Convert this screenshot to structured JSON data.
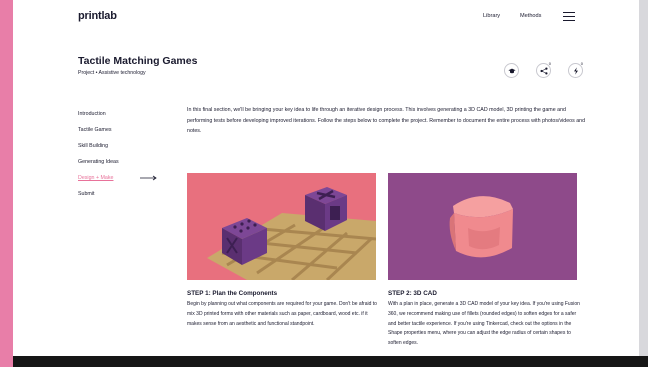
{
  "header": {
    "brand": "printlab",
    "nav": [
      {
        "label": "Library"
      },
      {
        "label": "Methods"
      }
    ]
  },
  "project": {
    "title": "Tactile Matching Games",
    "subtitle": "Project • Assistive technology"
  },
  "actions": {
    "share_count": "0",
    "bolt_count": "0"
  },
  "sidebar": {
    "items": [
      {
        "label": "Introduction"
      },
      {
        "label": "Tactile Games"
      },
      {
        "label": "Skill Building"
      },
      {
        "label": "Generating Ideas"
      },
      {
        "label": "Design + Make",
        "active": true
      },
      {
        "label": "Submit"
      }
    ]
  },
  "intro": "In this final section, we'll be bringing your key idea to life through an iterative design process. This involves generating a 3D CAD model, 3D printing the game and performing tests before developing improved iterations. Follow the steps below to complete the project. Remember to document the entire process with photos/videos and notes.",
  "steps": [
    {
      "title": "STEP 1: Plan the Components",
      "body": "Begin by planning out what components are required for your game. Don't be afraid to mix 3D printed forms with other materials such as paper, cardboard, wood etc. if it makes sense from an aesthetic and functional standpoint."
    },
    {
      "title": "STEP 2: 3D CAD",
      "body": "With a plan in place, generate a 3D CAD model of your key idea. If you're using Fusion 360, we recommend making use of fillets (rounded edges) to soften edges for a safer and better tactile experience. If you're using Tinkercad, check out the options in the Shape properties menu, where you can adjust the edge radius of certain shapes to soften edges."
    }
  ],
  "colors": {
    "background": "#e87ea8",
    "accent": "#e8729a",
    "image1_bg": "#e8707e",
    "image2_bg": "#8e4a8a",
    "cube_purple": "#6b3a86",
    "cube_pink": "#f08a8e",
    "wood": "#c9a86a"
  }
}
